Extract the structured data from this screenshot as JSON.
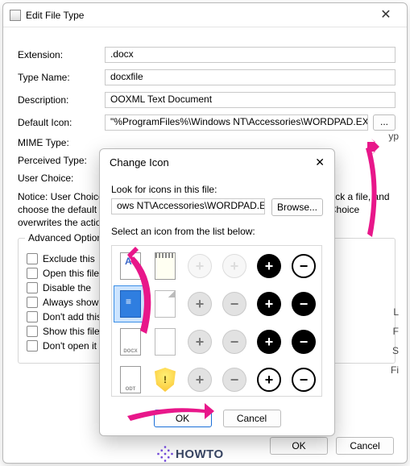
{
  "outer": {
    "title": "Edit File Type",
    "fields": {
      "extension_label": "Extension:",
      "extension_value": ".docx",
      "typename_label": "Type Name:",
      "typename_value": "docxfile",
      "description_label": "Description:",
      "description_value": "OOXML Text Document",
      "defaulticon_label": "Default Icon:",
      "defaulticon_value": "\"%ProgramFiles%\\Windows NT\\Accessories\\WORDPAD.EX",
      "browse_btn": "...",
      "mimetype_label": "MIME Type:",
      "perceivedtype_label": "Perceived Type:",
      "userchoice_label": "User Choice:"
    },
    "notice": "Notice: User Choice is the program that opens the file when you double-click a file, and choose the default program with OpenWith dialog-box of Windows. User Choice overwrites the actions and icon settings.",
    "group_title": "Advanced Options",
    "checks": {
      "exclude": "Exclude  this",
      "openthis": "Open this file",
      "disable": "Disable the",
      "alwaysshow": "Always show",
      "dontadd": "Don't add this",
      "showthis": "Show this file",
      "dontopen": "Don't open it"
    },
    "ok_btn": "OK",
    "cancel_btn": "Cancel",
    "sliver": {
      "yp": "yp",
      "L": "L",
      "F": "F",
      "S": "S",
      "Fi": "Fi"
    }
  },
  "inner": {
    "title": "Change Icon",
    "look_label": "Look for icons in this file:",
    "path_value": "ows NT\\Accessories\\WORDPAD.EXE",
    "browse_btn": "Browse...",
    "select_label": "Select an icon from the list below:",
    "ok_btn": "OK",
    "cancel_btn": "Cancel"
  },
  "watermark": "HOWTO"
}
